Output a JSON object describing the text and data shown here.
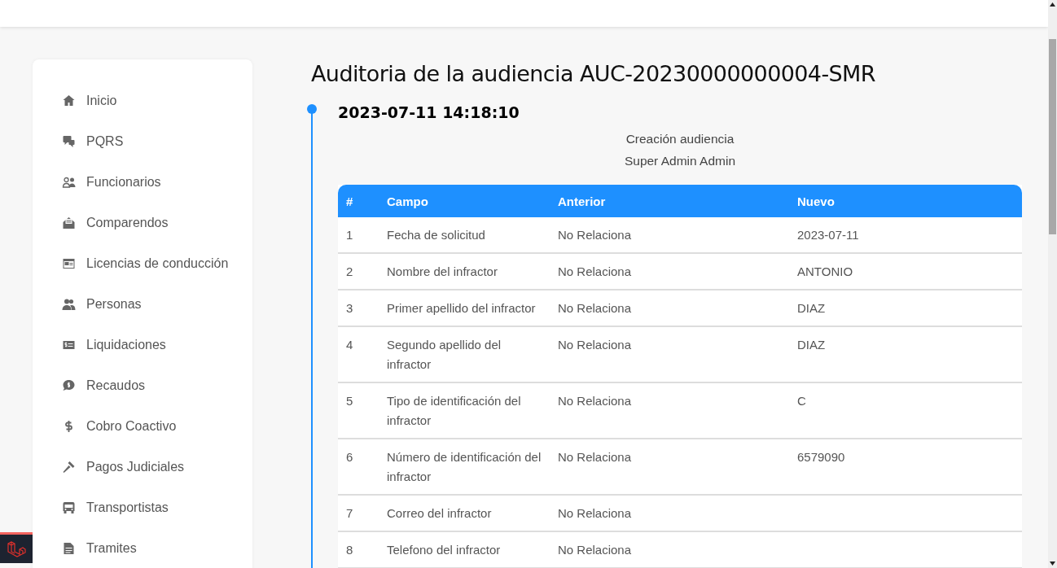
{
  "sidebar": {
    "items": [
      {
        "label": "Inicio",
        "kind": "home"
      },
      {
        "label": "PQRS",
        "kind": "chat-question"
      },
      {
        "label": "Funcionarios",
        "kind": "users"
      },
      {
        "label": "Comparendos",
        "kind": "envelope"
      },
      {
        "label": "Licencias de conducción",
        "kind": "id-card"
      },
      {
        "label": "Personas",
        "kind": "people"
      },
      {
        "label": "Liquidaciones",
        "kind": "money-card"
      },
      {
        "label": "Recaudos",
        "kind": "money-chat"
      },
      {
        "label": "Cobro Coactivo",
        "kind": "dollar"
      },
      {
        "label": "Pagos Judiciales",
        "kind": "gavel"
      },
      {
        "label": "Transportistas",
        "kind": "bus"
      },
      {
        "label": "Tramites",
        "kind": "document"
      }
    ]
  },
  "title": "Auditoria de la audiencia AUC-20230000000004-SMR",
  "timeline": [
    {
      "timestamp": "2023-07-11 14:18:10",
      "action": "Creación audiencia",
      "user": "Super Admin Admin",
      "table": {
        "columns": [
          "#",
          "Campo",
          "Anterior",
          "Nuevo"
        ],
        "rows": [
          [
            "1",
            "Fecha de solicitud",
            "No Relaciona",
            "2023-07-11"
          ],
          [
            "2",
            "Nombre del infractor",
            "No Relaciona",
            "ANTONIO"
          ],
          [
            "3",
            "Primer apellido del infractor",
            "No Relaciona",
            "DIAZ"
          ],
          [
            "4",
            "Segundo apellido del infractor",
            "No Relaciona",
            "DIAZ"
          ],
          [
            "5",
            "Tipo de identificación del infractor",
            "No Relaciona",
            "C"
          ],
          [
            "6",
            "Número de identificación del infractor",
            "No Relaciona",
            "6579090"
          ],
          [
            "7",
            "Correo del infractor",
            "No Relaciona",
            ""
          ],
          [
            "8",
            "Telefono del infractor",
            "No Relaciona",
            ""
          ]
        ]
      }
    }
  ]
}
